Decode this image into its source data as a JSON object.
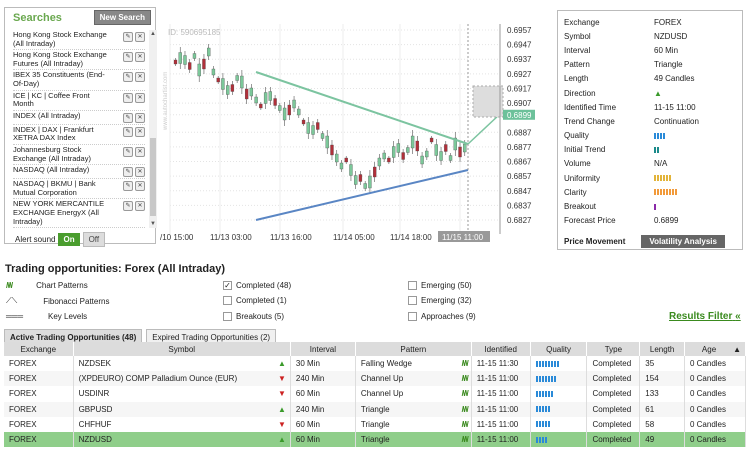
{
  "searches": {
    "title": "Searches",
    "new_search_label": "New Search",
    "items": [
      {
        "label": "Hong Kong Stock Exchange (All Intraday)"
      },
      {
        "label": "Hong Kong Stock Exchange Futures (All Intraday)"
      },
      {
        "label": "IBEX 35 Constituents (End-Of-Day)"
      },
      {
        "label": "ICE | KC | Coffee Front Month"
      },
      {
        "label": "INDEX (All Intraday)"
      },
      {
        "label": "INDEX | DAX | Frankfurt XETRA DAX Index"
      },
      {
        "label": "Johannesburg Stock Exchange (All Intraday)"
      },
      {
        "label": "NASDAQ (All Intraday)"
      },
      {
        "label": "NASDAQ | BKMU | Bank Mutual Corporation"
      },
      {
        "label": "NEW YORK MERCANTILE EXCHANGE EnergyX (All Intraday)"
      }
    ],
    "alert_label": "Alert sound",
    "on_label": "On",
    "off_label": "Off"
  },
  "chart": {
    "id_label": "ID: 590695185",
    "watermark": "www.autochartist.com",
    "price_ticks": [
      "0.6957",
      "0.6947",
      "0.6937",
      "0.6927",
      "0.6917",
      "0.6907",
      "0.6899",
      "0.6887",
      "0.6877",
      "0.6867",
      "0.6857",
      "0.6847",
      "0.6837",
      "0.6827"
    ],
    "time_ticks": [
      "/10 15:00",
      "11/13 03:00",
      "11/13 16:00",
      "11/14 05:00",
      "11/14 18:00",
      "11/15 11:00"
    ],
    "current_price": "0.6899"
  },
  "info": {
    "rows": [
      {
        "k": "Exchange",
        "v": "FOREX"
      },
      {
        "k": "Symbol",
        "v": "NZDUSD"
      },
      {
        "k": "Interval",
        "v": "60 Min"
      },
      {
        "k": "Pattern",
        "v": "Triangle"
      },
      {
        "k": "Length",
        "v": "49 Candles"
      },
      {
        "k": "Direction",
        "v": ""
      },
      {
        "k": "Identified Time",
        "v": "11-15 11:00"
      },
      {
        "k": "Trend Change",
        "v": "Continuation"
      },
      {
        "k": "Quality",
        "v": ""
      },
      {
        "k": "Initial Trend",
        "v": ""
      },
      {
        "k": "Volume",
        "v": "N/A"
      },
      {
        "k": "Uniformity",
        "v": ""
      },
      {
        "k": "Clarity",
        "v": ""
      },
      {
        "k": "Breakout",
        "v": ""
      },
      {
        "k": "Forecast Price",
        "v": "0.6899"
      }
    ],
    "price_movement_label": "Price Movement",
    "volatility_label": "Volatility Analysis"
  },
  "opportunities": {
    "title": "Trading opportunities: Forex (All Intraday)",
    "legend": {
      "chart": "Chart Patterns",
      "fib": "Fibonacci Patterns",
      "key": "Key Levels"
    },
    "filters": {
      "completed48": "Completed (48)",
      "completed1": "Completed (1)",
      "breakouts5": "Breakouts (5)",
      "emerging50": "Emerging (50)",
      "emerging32": "Emerging (32)",
      "approaches9": "Approaches (9)"
    },
    "results_filter_label": "Results Filter",
    "tabs": {
      "active": "Active Trading Opportunities (48)",
      "expired": "Expired Trading Opportunities (2)"
    },
    "columns": {
      "exchange": "Exchange",
      "symbol": "Symbol",
      "interval": "Interval",
      "pattern": "Pattern",
      "identified": "Identified",
      "quality": "Quality",
      "type": "Type",
      "length": "Length",
      "age": "Age"
    }
  },
  "table_rows": [
    {
      "exchange": "FOREX",
      "symbol": "NZDSEK",
      "dir": "up",
      "interval": "30 Min",
      "pattern": "Falling Wedge",
      "identified": "11-15 11:30",
      "quality": 8,
      "type": "Completed",
      "length": "35",
      "age": "0 Candles"
    },
    {
      "exchange": "FOREX",
      "symbol": "(XPDEURO) COMP Palladium Ounce (EUR)",
      "dir": "down",
      "interval": "240 Min",
      "pattern": "Channel Up",
      "identified": "11-15 11:00",
      "quality": 7,
      "type": "Completed",
      "length": "154",
      "age": "0 Candles"
    },
    {
      "exchange": "FOREX",
      "symbol": "USDINR",
      "dir": "down",
      "interval": "60 Min",
      "pattern": "Channel Up",
      "identified": "11-15 11:00",
      "quality": 6,
      "type": "Completed",
      "length": "133",
      "age": "0 Candles"
    },
    {
      "exchange": "FOREX",
      "symbol": "GBPUSD",
      "dir": "up",
      "interval": "240 Min",
      "pattern": "Triangle",
      "identified": "11-15 11:00",
      "quality": 5,
      "type": "Completed",
      "length": "61",
      "age": "0 Candles"
    },
    {
      "exchange": "FOREX",
      "symbol": "CHFHUF",
      "dir": "down",
      "interval": "60 Min",
      "pattern": "Triangle",
      "identified": "11-15 11:00",
      "quality": 5,
      "type": "Completed",
      "length": "58",
      "age": "0 Candles"
    },
    {
      "exchange": "FOREX",
      "symbol": "NZDUSD",
      "dir": "up",
      "interval": "60 Min",
      "pattern": "Triangle",
      "identified": "11-15 11:00",
      "quality": 4,
      "type": "Completed",
      "length": "49",
      "age": "0 Candles"
    }
  ],
  "colors": {
    "accent": "#6aa84f",
    "selected_row": "#8fce8a",
    "quality_bar": "#2a8ad8",
    "up": "#3a9a2a",
    "down": "#cc2222"
  }
}
